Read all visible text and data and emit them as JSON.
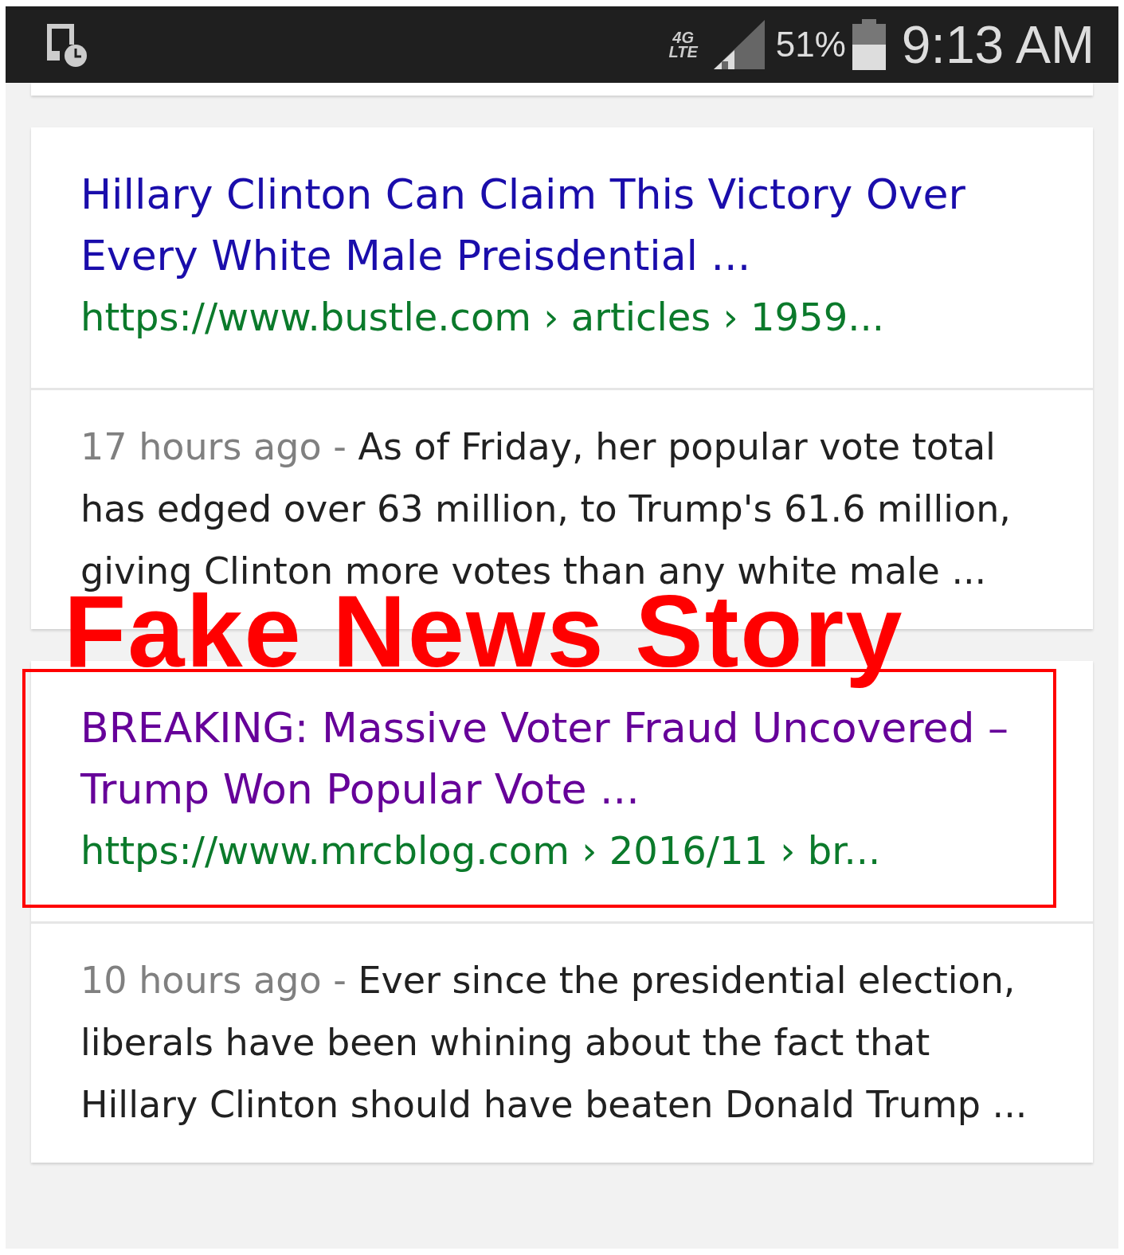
{
  "status_bar": {
    "network": [
      "4G",
      "LTE"
    ],
    "battery": "51%",
    "time": "9:13 AM"
  },
  "results": [
    {
      "title": "Hillary Clinton Can Claim This Victory Over Every White Male Preisdential ...",
      "url": "https://www.bustle.com › articles › 1959...",
      "visited": false,
      "highlighted": false,
      "age": "17 hours ago -",
      "snippet": "As of Friday, her popular vote total has edged over 63 million, to Trump's 61.6 million, giving Clinton more votes than any white male ..."
    },
    {
      "title": "BREAKING: Massive Voter Fraud Uncovered – Trump Won Popular Vote ...",
      "url": "https://www.mrcblog.com › 2016/11 › br...",
      "visited": true,
      "highlighted": true,
      "age": "10 hours ago -",
      "snippet": "Ever since the presidential election, liberals have been whining about the fact that Hillary Clinton should have beaten Donald Trump ..."
    }
  ],
  "annotation": {
    "label": "Fake News Story"
  }
}
